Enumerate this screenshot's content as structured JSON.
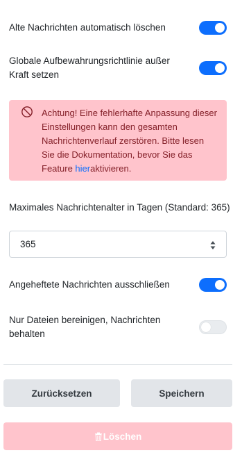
{
  "settings": {
    "auto_delete_label": "Alte Nachrichten automatisch löschen",
    "override_global_label": "Globale Aufbewahrungsrichtlinie außer Kraft setzen",
    "exclude_pinned_label": "Angeheftete Nachrichten ausschließen",
    "files_only_label": "Nur Dateien bereinigen, Nachrichten behalten"
  },
  "toggles": {
    "auto_delete": true,
    "override_global": true,
    "exclude_pinned": true,
    "files_only": false
  },
  "alert": {
    "text_before_link": "Achtung! Eine fehlerhafte Anpassung dieser Einstellungen kann den gesamten Nachrichtenverlauf zerstören. Bitte lesen Sie die Dokumentation, bevor Sie das Feature ",
    "link_text": "hier",
    "text_after_link": "aktivieren."
  },
  "max_age": {
    "label": "Maximales Nachrichtenalter in Tagen (Standard: 365)",
    "value": "365"
  },
  "buttons": {
    "reset_label": "Zurücksetzen",
    "save_label": "Speichern",
    "delete_label": "Löschen"
  },
  "colors": {
    "toggle_on": "#0d6efd",
    "alert_bg": "#ffc4cc",
    "alert_text": "#842029",
    "link": "#0d6efd",
    "button_secondary": "#e2e5e9",
    "button_danger_disabled": "#ffc4cc"
  },
  "icons": {
    "alert": "ban-icon",
    "delete": "trash-icon",
    "spinner": "spinner-arrows-icon"
  }
}
